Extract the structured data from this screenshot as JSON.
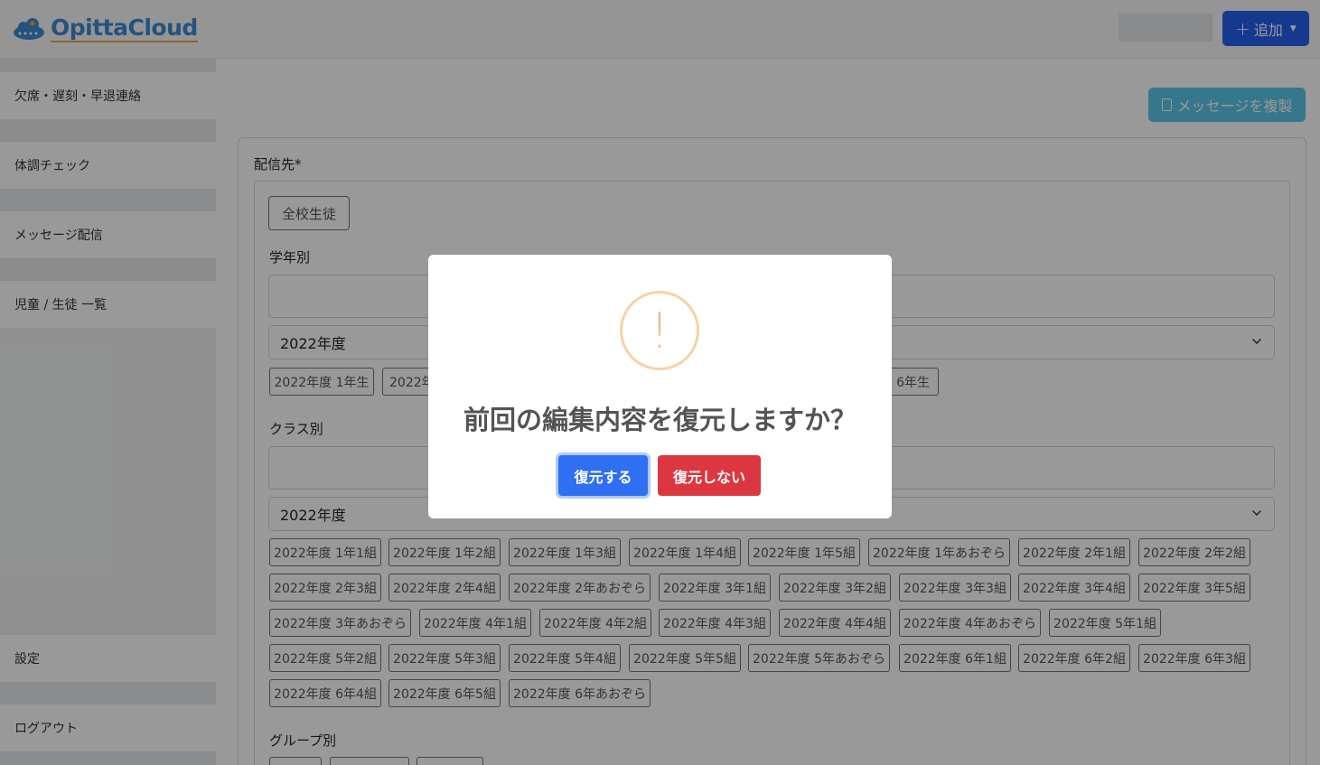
{
  "header": {
    "logo_text": "OpittaCloud",
    "add_button": {
      "plus": "+",
      "label": "追加"
    }
  },
  "sidebar": {
    "items": [
      {
        "label": "欠席・遅刻・早退連絡"
      },
      {
        "label": "体調チェック"
      },
      {
        "label": "メッセージ配信"
      },
      {
        "label": "児童 / 生徒 一覧"
      },
      {
        "label": "設定"
      },
      {
        "label": "ログアウト"
      }
    ]
  },
  "main": {
    "copy_button": "メッセージを複製",
    "recipient_label": "配信先*",
    "all_students_button": "全校生徒",
    "grade_section": {
      "label": "学年別",
      "year_select": "2022年度",
      "chips": [
        "2022年度 1年生",
        "2022年",
        "6年生"
      ]
    },
    "class_section": {
      "label": "クラス別",
      "year_select": "2022年度",
      "chips": [
        "2022年度 1年1組",
        "2022年度 1年2組",
        "2022年度 1年3組",
        "2022年度 1年4組",
        "2022年度 1年5組",
        "2022年度 1年あおぞら",
        "2022年度 2年1組",
        "2022年度 2年2組",
        "2022年度 2年3組",
        "2022年度 2年4組",
        "2022年度 2年あおぞら",
        "2022年度 3年1組",
        "2022年度 3年2組",
        "2022年度 3年3組",
        "2022年度 3年4組",
        "2022年度 3年5組",
        "2022年度 3年あおぞら",
        "2022年度 4年1組",
        "2022年度 4年2組",
        "2022年度 4年3組",
        "2022年度 4年4組",
        "2022年度 4年あおぞら",
        "2022年度 5年1組",
        "2022年度 5年2組",
        "2022年度 5年3組",
        "2022年度 5年4組",
        "2022年度 5年5組",
        "2022年度 5年あおぞら",
        "2022年度 6年1組",
        "2022年度 6年2組",
        "2022年度 6年3組",
        "2022年度 6年4組",
        "2022年度 6年5組",
        "2022年度 6年あおぞら"
      ]
    },
    "group_section": {
      "label": "グループ別"
    }
  },
  "modal": {
    "icon": "exclamation-icon",
    "icon_glyph": "!",
    "title": "前回の編集内容を復元しますか？",
    "confirm_button": "復元する",
    "deny_button": "復元しない"
  }
}
